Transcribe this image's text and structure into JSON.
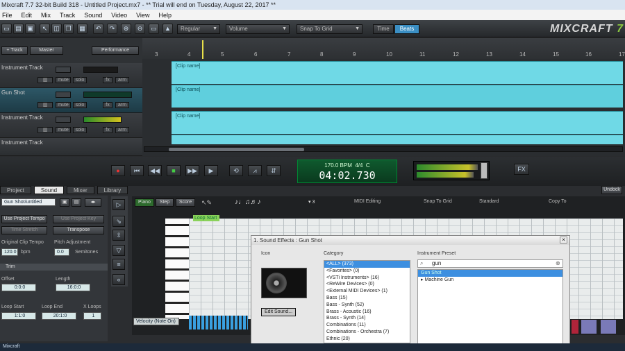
{
  "window": {
    "title": "Mixcraft 7.7 32-bit Build 318 - Untitled Project.mx7 - ** Trial will end on Tuesday, August 22, 2017 **"
  },
  "menu": [
    "File",
    "Edit",
    "Mix",
    "Track",
    "Sound",
    "Video",
    "View",
    "Help"
  ],
  "toolbar": {
    "mode_select": "Regular",
    "view_select": "Volume",
    "snap_select": "Snap To Grid",
    "time_tab": "Time",
    "beats_tab": "Beats",
    "logo_a": "MIXCRAFT",
    "logo_b": "7"
  },
  "track_toolbar": {
    "add_track": "+ Track",
    "master": "Master",
    "performance": "Performance"
  },
  "ruler": {
    "bars": [
      "3",
      "4",
      "5",
      "6",
      "7",
      "8",
      "9",
      "10",
      "11",
      "12",
      "13",
      "14",
      "15",
      "16",
      "17"
    ]
  },
  "tracks": [
    {
      "name": "Instrument Track",
      "clip": "[Clip name]"
    },
    {
      "name": "Gun Shot",
      "clip": "[Clip name]"
    },
    {
      "name": "Instrument Track",
      "clip": "[Clip name]"
    },
    {
      "name": "Instrument Track",
      "clip": ""
    }
  ],
  "track_buttons": {
    "mute": "mute",
    "solo": "solo",
    "fx": "fx",
    "arm": "arm"
  },
  "transport": {
    "tempo": "170.0 BPM",
    "time_sig": "4/4",
    "key": "C",
    "position": "04:02.730",
    "fx": "FX"
  },
  "bottom_tabs": [
    "Project",
    "Sound",
    "Mixer",
    "Library"
  ],
  "bottom_right_btn": "Undock",
  "sound_panel": {
    "name": "Gun Shot/untitled",
    "use_project_tempo": "Use Project Tempo",
    "time_stretch": "Time Stretch",
    "use_project_key": "Use Project Key",
    "transpose": "Transpose",
    "original_clip_tempo": "Original Clip Tempo",
    "bpm_value": "120.0",
    "bpm_unit": "bpm",
    "pitch_adjustment": "Pitch Adjustment",
    "pitch_value": "0.0",
    "semitones": "Semitones",
    "trim_tab": "Trim",
    "offset_label": "Offset",
    "offset_value": "0:0:0",
    "length_label": "Length",
    "length_value": "16:0:0",
    "loop_start_label": "Loop Start",
    "loop_start_value": "1:1:0",
    "loop_end_label": "Loop End",
    "loop_end_value": "20:1:0",
    "x_loops_label": "X Loops",
    "x_loops_value": "1"
  },
  "piano_toolbar": {
    "piano": "Piano",
    "step": "Step",
    "score": "Score",
    "midi_editing": "MIDI Editing",
    "snap": "Snap To Grid",
    "standard": "Standard",
    "copy_to": "Copy To",
    "loop_start": "Loop Start",
    "velocity_select": "Velocity (Note On)"
  },
  "dialog": {
    "title": "1. Sound Effects : Gun Shot",
    "icon_label": "Icon",
    "category_label": "Category",
    "preset_label": "Instrument Preset",
    "edit_sound": "Edit Sound...",
    "search_value": "gun",
    "categories": [
      "<ALL> (373)",
      "<Favorites> (0)",
      "<VSTi Instruments> (16)",
      "<ReWire Devices> (0)",
      "<External MIDI Devices> (1)",
      "Bass (15)",
      "Bass - Synth (52)",
      "Brass - Acoustic (16)",
      "Brass - Synth (14)",
      "Combinations (11)",
      "Combinations - Orchestra (7)",
      "Ethnic (20)"
    ],
    "presets": [
      "Gun Shot",
      "Machine Gun"
    ]
  },
  "taskbar": {
    "status": "Mixcraft"
  }
}
